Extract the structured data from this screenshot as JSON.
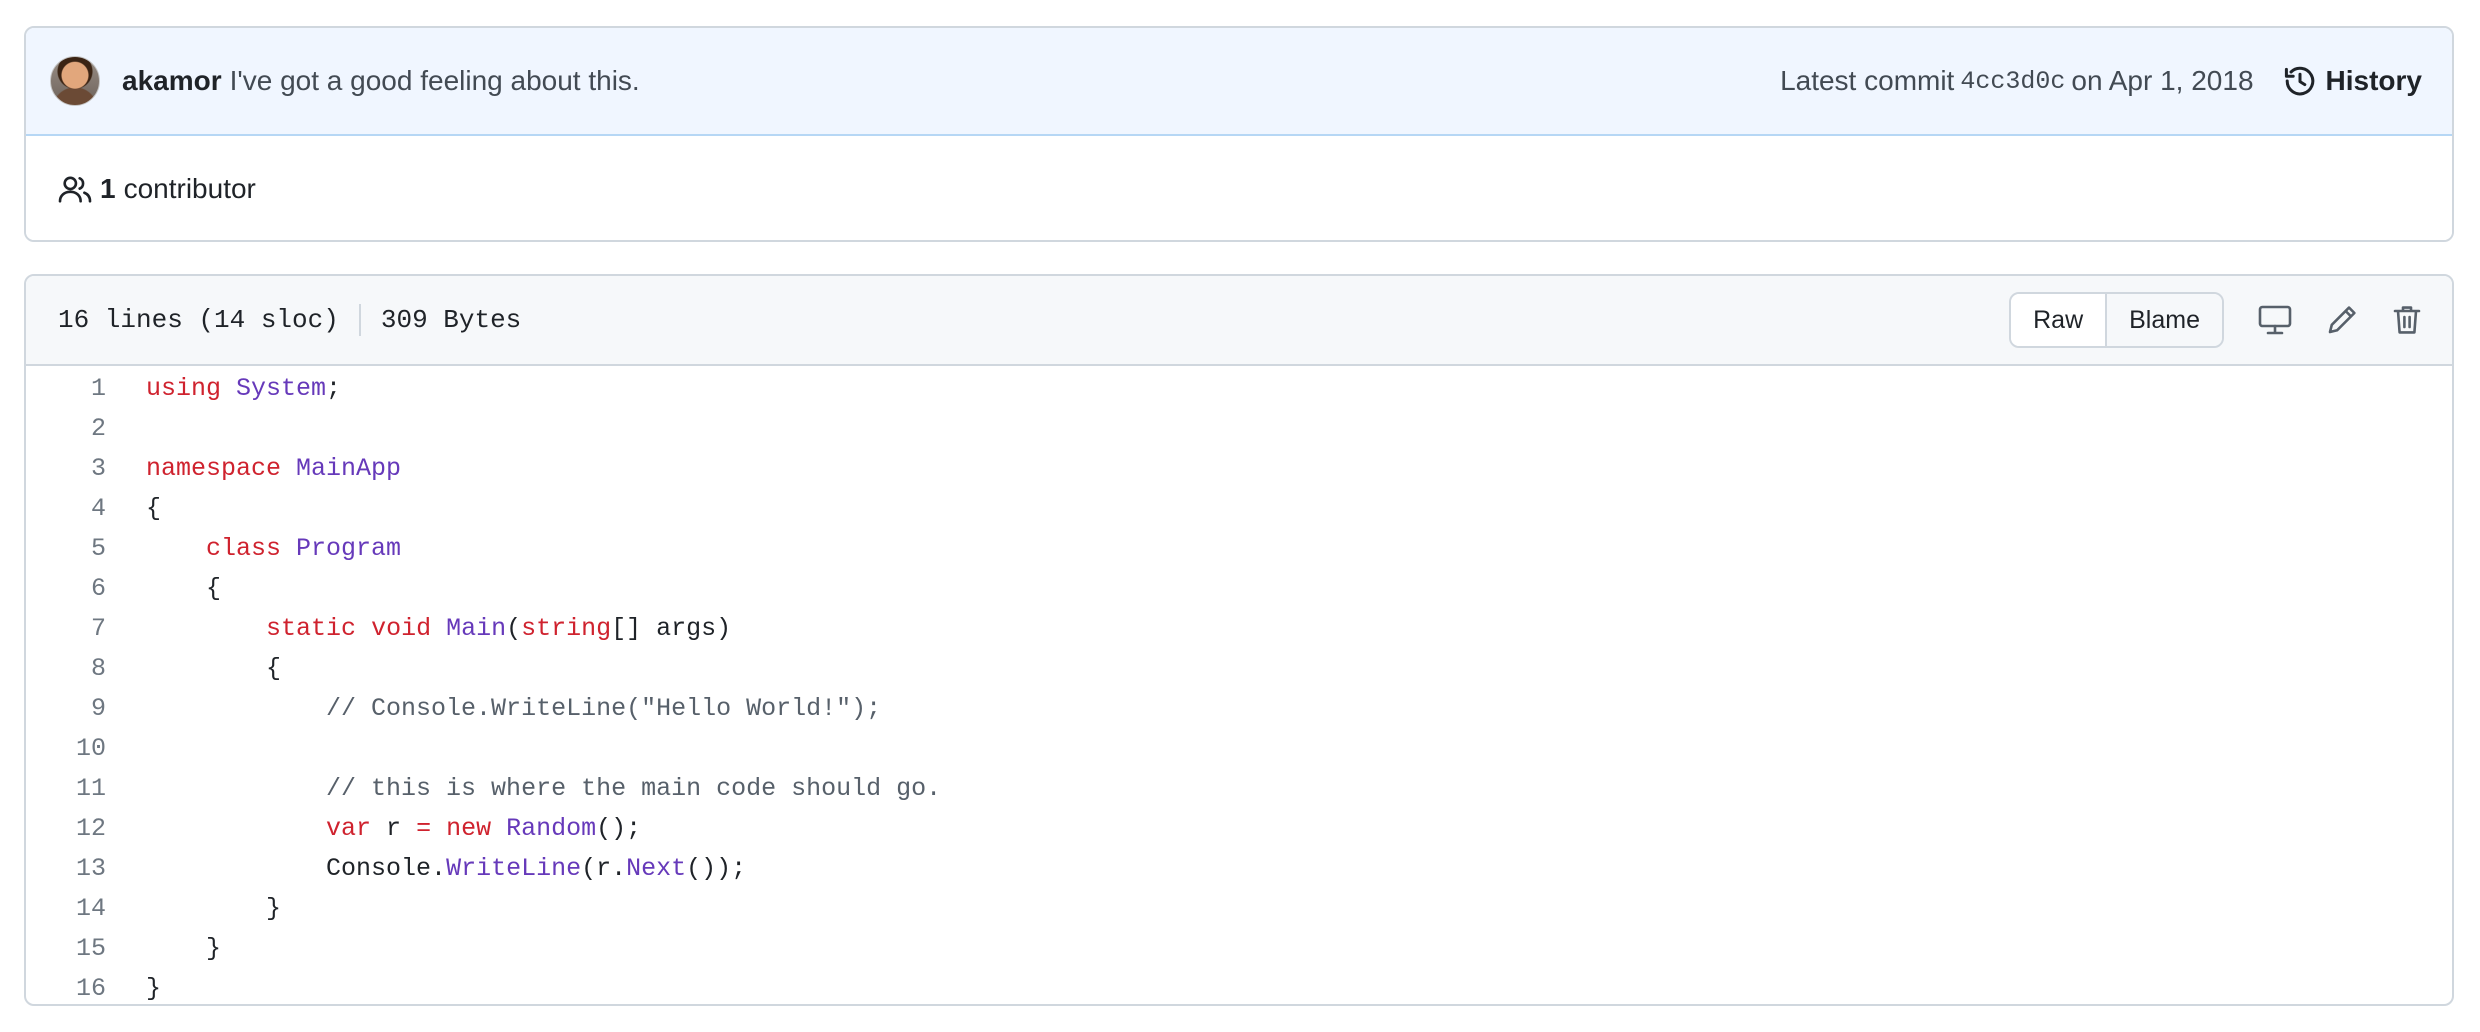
{
  "commit": {
    "author": "akamor",
    "message": "I've got a good feeling about this.",
    "latest_label": "Latest commit",
    "sha": "4cc3d0c",
    "date_text": "on Apr 1, 2018",
    "history_label": "History",
    "contributors_count": "1",
    "contributors_label": "contributor"
  },
  "file": {
    "lines_info": "16 lines (14 sloc)",
    "size": "309 Bytes",
    "raw_label": "Raw",
    "blame_label": "Blame"
  },
  "icons": [
    "avatar",
    "history-icon",
    "people-icon",
    "desktop-icon",
    "pencil-icon",
    "trash-icon"
  ],
  "colors": {
    "keyword": "#cf222e",
    "type": "#6639ba",
    "comment": "#57606a",
    "header_bg": "#f0f6ff"
  },
  "code_lines": [
    [
      {
        "t": "using",
        "c": "kw"
      },
      {
        "t": " "
      },
      {
        "t": "System",
        "c": "ty"
      },
      {
        "t": ";"
      }
    ],
    [],
    [
      {
        "t": "namespace",
        "c": "kw"
      },
      {
        "t": " "
      },
      {
        "t": "MainApp",
        "c": "ty"
      }
    ],
    [
      {
        "t": "{"
      }
    ],
    [
      {
        "t": "    "
      },
      {
        "t": "class",
        "c": "kw"
      },
      {
        "t": " "
      },
      {
        "t": "Program",
        "c": "ty"
      }
    ],
    [
      {
        "t": "    {"
      }
    ],
    [
      {
        "t": "        "
      },
      {
        "t": "static",
        "c": "kw"
      },
      {
        "t": " "
      },
      {
        "t": "void",
        "c": "kw"
      },
      {
        "t": " "
      },
      {
        "t": "Main",
        "c": "ty"
      },
      {
        "t": "("
      },
      {
        "t": "string",
        "c": "kw"
      },
      {
        "t": "[] args)"
      }
    ],
    [
      {
        "t": "        {"
      }
    ],
    [
      {
        "t": "            "
      },
      {
        "t": "// Console.WriteLine(\"Hello World!\");",
        "c": "cm"
      }
    ],
    [],
    [
      {
        "t": "            "
      },
      {
        "t": "// this is where the main code should go.",
        "c": "cm"
      }
    ],
    [
      {
        "t": "            "
      },
      {
        "t": "var",
        "c": "kw"
      },
      {
        "t": " r "
      },
      {
        "t": "=",
        "c": "kw"
      },
      {
        "t": " "
      },
      {
        "t": "new",
        "c": "kw"
      },
      {
        "t": " "
      },
      {
        "t": "Random",
        "c": "ty"
      },
      {
        "t": "();"
      }
    ],
    [
      {
        "t": "            Console."
      },
      {
        "t": "WriteLine",
        "c": "ty"
      },
      {
        "t": "(r."
      },
      {
        "t": "Next",
        "c": "ty"
      },
      {
        "t": "());"
      }
    ],
    [
      {
        "t": "        }"
      }
    ],
    [
      {
        "t": "    }"
      }
    ],
    [
      {
        "t": "}"
      }
    ]
  ]
}
